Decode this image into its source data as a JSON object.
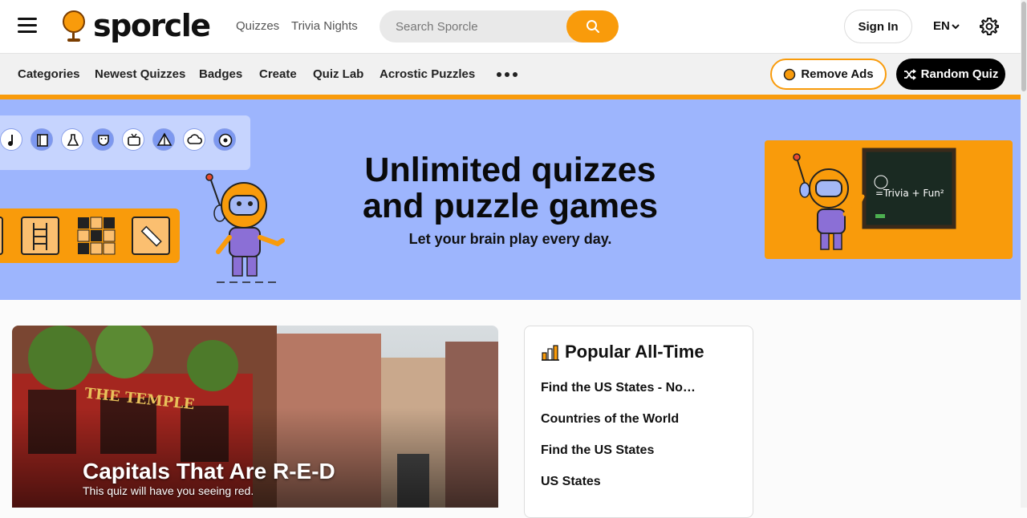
{
  "header": {
    "logo_text": "sporcle",
    "links": [
      "Quizzes",
      "Trivia Nights"
    ],
    "search_placeholder": "Search Sporcle",
    "signin_label": "Sign In",
    "language": "EN"
  },
  "nav": {
    "items": [
      "Categories",
      "Newest Quizzes",
      "Badges",
      "Create",
      "Quiz Lab",
      "Acrostic Puzzles"
    ],
    "remove_ads_label": "Remove Ads",
    "random_quiz_label": "Random Quiz"
  },
  "hero": {
    "title_line1": "Unlimited quizzes",
    "title_line2": "and puzzle games",
    "subtitle": "Let your brain play every day.",
    "chalkboard_text": "=Trivia + Fun²"
  },
  "featured": {
    "title": "Capitals That Are R-E-D",
    "subtitle": "This quiz will have you seeing red."
  },
  "popular": {
    "heading": "Popular All-Time",
    "items": [
      "Find the US States - No…",
      "Countries of the World",
      "Find the US States",
      "US States"
    ]
  },
  "colors": {
    "brand_orange": "#f99b0b",
    "hero_blue": "#9db5fd",
    "nav_gray": "#f1f1f1"
  }
}
